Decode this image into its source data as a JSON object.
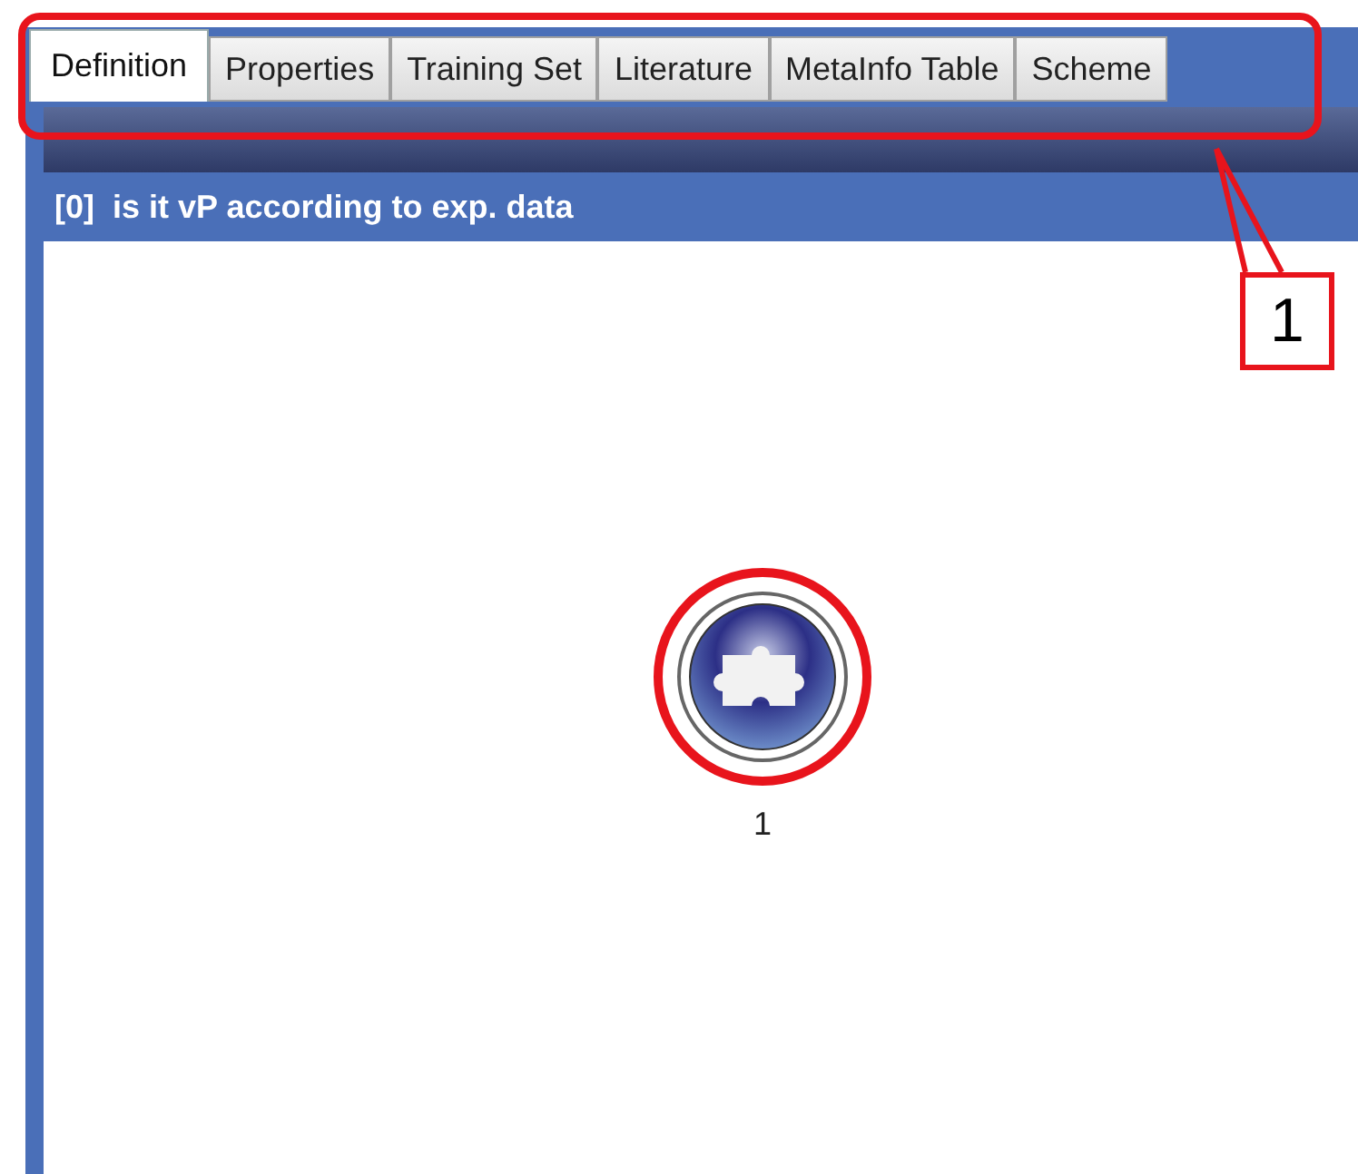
{
  "tabs": [
    {
      "label": "Definition",
      "selected": true
    },
    {
      "label": "Properties",
      "selected": false
    },
    {
      "label": "Training Set",
      "selected": false
    },
    {
      "label": "Literature",
      "selected": false
    },
    {
      "label": "MetaInfo Table",
      "selected": false
    },
    {
      "label": "Scheme",
      "selected": false
    }
  ],
  "panel": {
    "title": "[0]  is it vP according to exp. data"
  },
  "nodes": [
    {
      "label": "1",
      "highlighted": true
    }
  ],
  "callout": {
    "label": "1"
  }
}
